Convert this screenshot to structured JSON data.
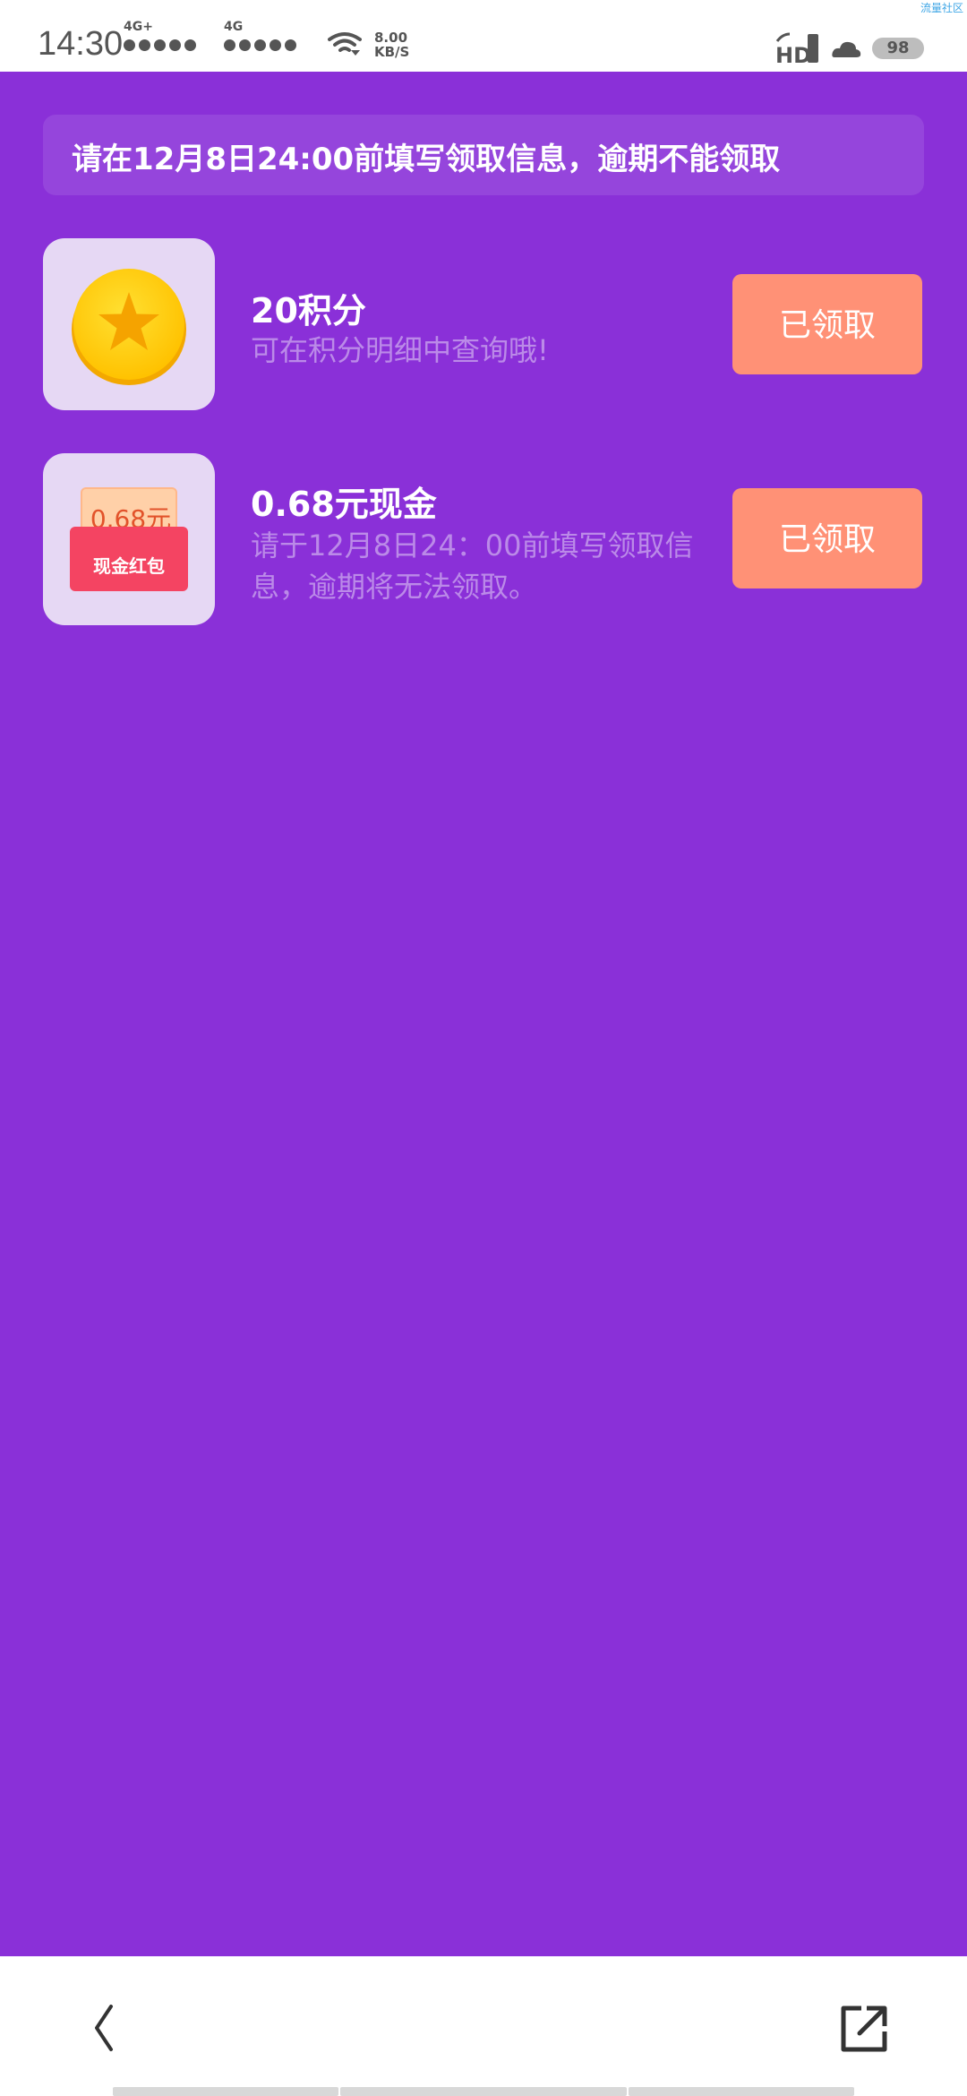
{
  "status_bar": {
    "time": "14:30",
    "sim1_type": "4G+",
    "sim2_type": "4G",
    "net_speed_value": "8.00",
    "net_speed_unit": "KB/S",
    "hd_badge": "HD",
    "battery": "98",
    "watermark": "流量社区"
  },
  "notice": {
    "text": "请在12月8日24:00前填写领取信息，逾期不能领取"
  },
  "rewards": [
    {
      "title": "20积分",
      "desc": "可在积分明细中查询哦!",
      "button_label": "已领取",
      "icon": "star-coin-icon"
    },
    {
      "title": "0.68元现金",
      "desc": "请于12月8日24：00前填写领取信息，逾期将无法领取。",
      "button_label": "已领取",
      "icon": "red-envelope-icon",
      "envelope_amount": "0.68元",
      "envelope_label": "现金红包"
    }
  ],
  "colors": {
    "background": "#8a30d8",
    "button": "#ff9176",
    "thumb": "#e6d8f4",
    "desc_text": "#bb8ae8"
  },
  "bottom_nav": {
    "back_icon": "chevron-left-icon",
    "share_icon": "share-external-icon"
  }
}
